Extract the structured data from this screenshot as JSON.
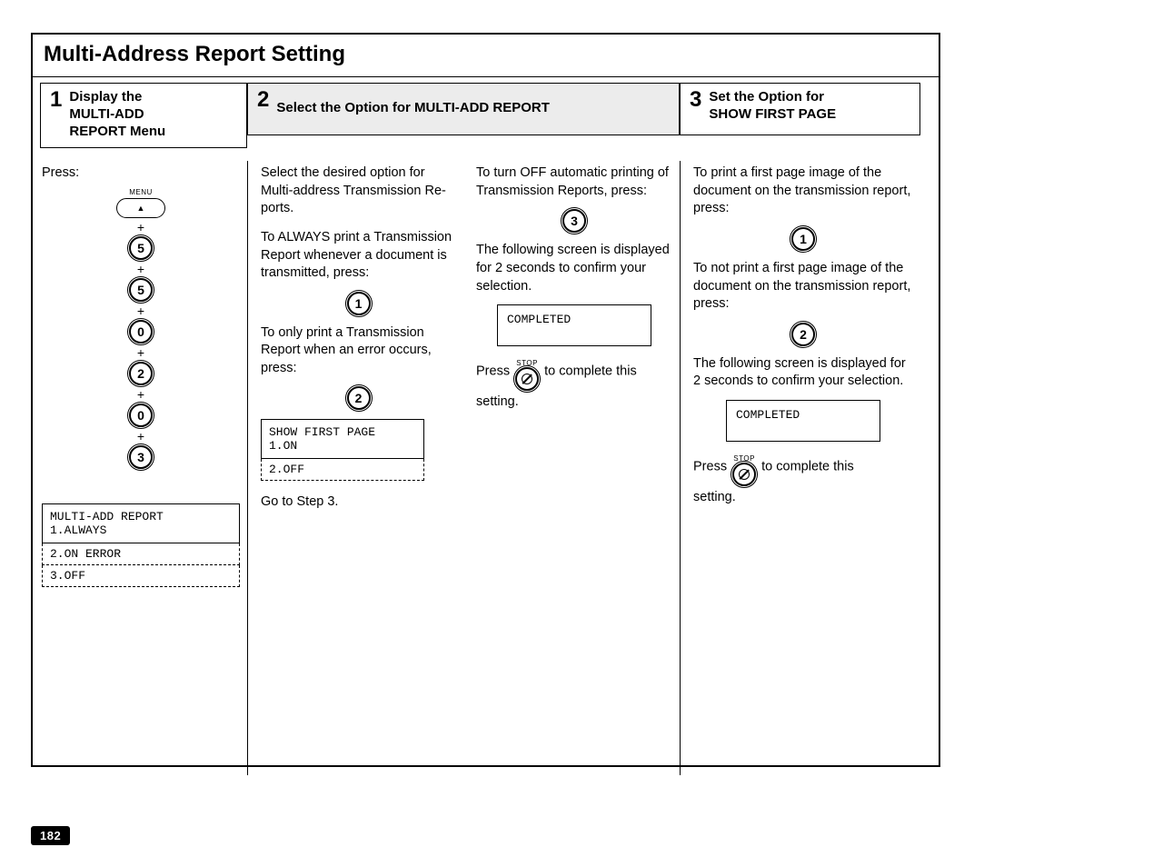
{
  "section_title": "Multi-Address Report Setting",
  "step1": {
    "num": "1",
    "title_l1": "Display the",
    "title_l2": "MULTI-ADD",
    "title_l3": "REPORT Menu"
  },
  "step2": {
    "num": "2",
    "title": "Select the Option for MULTI-ADD REPORT"
  },
  "step3": {
    "num": "3",
    "title_l1": "Set the Option for",
    "title_l2": "SHOW FIRST PAGE"
  },
  "page_number": "182",
  "col1": {
    "press_label": "Press:",
    "menu_label": "MENU",
    "keys": [
      "5",
      "5",
      "0",
      "2",
      "0",
      "3"
    ],
    "lcd_line1": "MULTI-ADD REPORT",
    "lcd_line2": "1.ALWAYS",
    "lcd_line3": "2.ON ERROR",
    "lcd_line4": "3.OFF"
  },
  "col2": {
    "p1": "Select the desired option for Multi-address Transmission Re­ports.",
    "p2": "To ALWAYS print a Transmis­sion Report whenever a docu­ment is transmitted, press:",
    "key_always": "1",
    "p3": "To only print a Transmission Report when an error occurs, press:",
    "key_error": "2",
    "lcd_line1": "SHOW FIRST PAGE",
    "lcd_line2": "1.ON",
    "lcd_line3": "2.OFF",
    "goto": "Go to Step 3."
  },
  "col3": {
    "p1": "To turn OFF automatic printing of Transmission Reports, press:",
    "key_off": "3",
    "p2": "The following screen is dis­played for 2 seconds to confirm your selection.",
    "lcd_completed": "COMPLETED",
    "press_word": "Press",
    "stop_label": "STOP",
    "press_tail": " to complete this",
    "setting_word": "setting."
  },
  "col4": {
    "p1": "To print a first page image of the document on the transmis­sion report, press:",
    "key_on": "1",
    "p2": "To not print a first page image of the document on the trans­mission report, press:",
    "key_off": "2",
    "p3": "The following screen is dis­played for 2 seconds to con­firm your selection.",
    "lcd_completed": "COMPLETED",
    "press_word": "Press",
    "stop_label": "STOP",
    "press_tail": " to complete this",
    "setting_word": "setting."
  }
}
